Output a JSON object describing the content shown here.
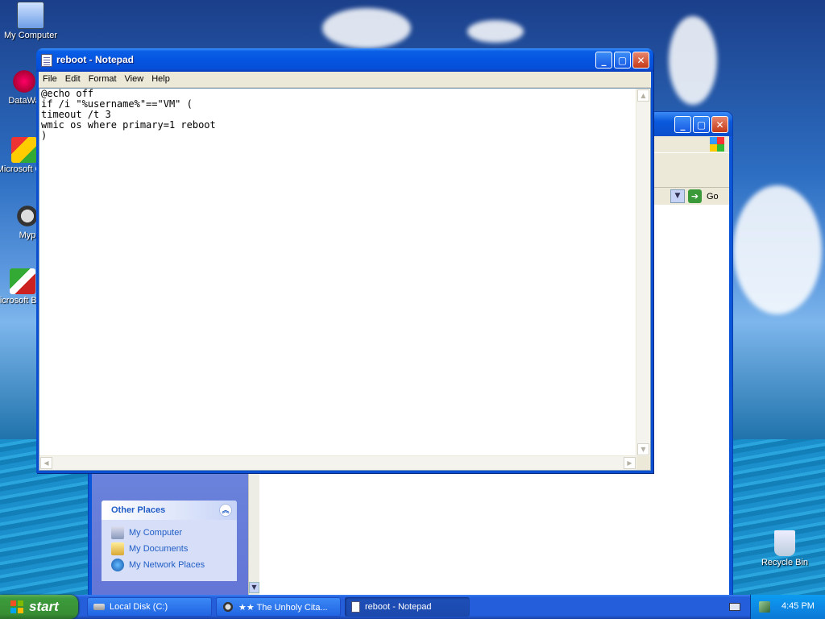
{
  "desktop": {
    "icons": [
      {
        "label": "My Computer"
      },
      {
        "label": "DataWa"
      },
      {
        "label": "Microsoft C++"
      },
      {
        "label": "Myp"
      },
      {
        "label": "Microsoft Basic"
      },
      {
        "label": "Recycle Bin"
      }
    ]
  },
  "explorer": {
    "address_go": "Go",
    "other_places": {
      "title": "Other Places",
      "items": [
        "My Computer",
        "My Documents",
        "My Network Places"
      ]
    }
  },
  "notepad": {
    "title": "reboot - Notepad",
    "menu": [
      "File",
      "Edit",
      "Format",
      "View",
      "Help"
    ],
    "content": "@echo off\nif /i \"%username%\"==\"VM\" (\ntimeout /t 3\nwmic os where primary=1 reboot\n)"
  },
  "taskbar": {
    "start_label": "start",
    "buttons": [
      {
        "label": "Local Disk (C:)"
      },
      {
        "label": "★★ The Unholy Cita..."
      },
      {
        "label": "reboot - Notepad"
      }
    ],
    "clock": "4:45 PM"
  },
  "colors": {
    "titlebar": "#0a5fe6",
    "start_green": "#388e33",
    "taskbar_blue": "#245edb"
  }
}
